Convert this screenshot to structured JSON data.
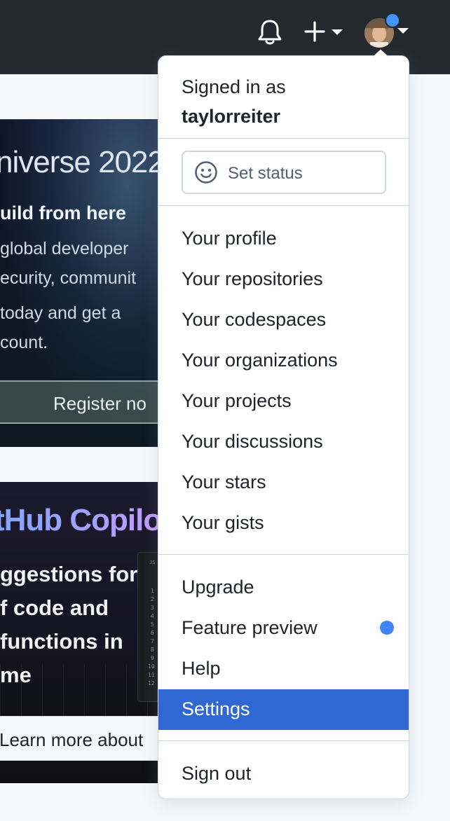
{
  "header": {
    "notifications_icon": "bell-icon",
    "create_icon": "plus-icon",
    "avatar_alt": "taylorreiter avatar"
  },
  "background": {
    "universe_card": {
      "title": "niverse 2022",
      "subtitle": "uild from here",
      "lines": [
        "global developer",
        "ecurity, communit",
        "today and get a",
        "count."
      ],
      "button_label": "Register no"
    },
    "copilot_card": {
      "title": "tHub Copilo",
      "lines": [
        "ggestions for",
        "f code and",
        "functions in",
        "me"
      ],
      "code_header": "JS",
      "line_numbers": [
        "1",
        "2",
        "3",
        "4",
        "5",
        "6",
        "7",
        "8",
        "9",
        "10",
        "11",
        "12"
      ],
      "button_label": "Learn more about"
    }
  },
  "menu": {
    "signed_in_label": "Signed in as",
    "username": "taylorreiter",
    "set_status_label": "Set status",
    "profile_items": [
      "Your profile",
      "Your repositories",
      "Your codespaces",
      "Your organizations",
      "Your projects",
      "Your discussions",
      "Your stars",
      "Your gists"
    ],
    "misc_items": [
      "Upgrade",
      "Feature preview",
      "Help",
      "Settings"
    ],
    "active_item": "Settings",
    "sign_out_label": "Sign out"
  },
  "colors": {
    "header_bg": "#24292f",
    "accent_active": "#2f68d2",
    "notification_dot": "#4493f8",
    "feature_preview_dot": "#4183f4"
  }
}
